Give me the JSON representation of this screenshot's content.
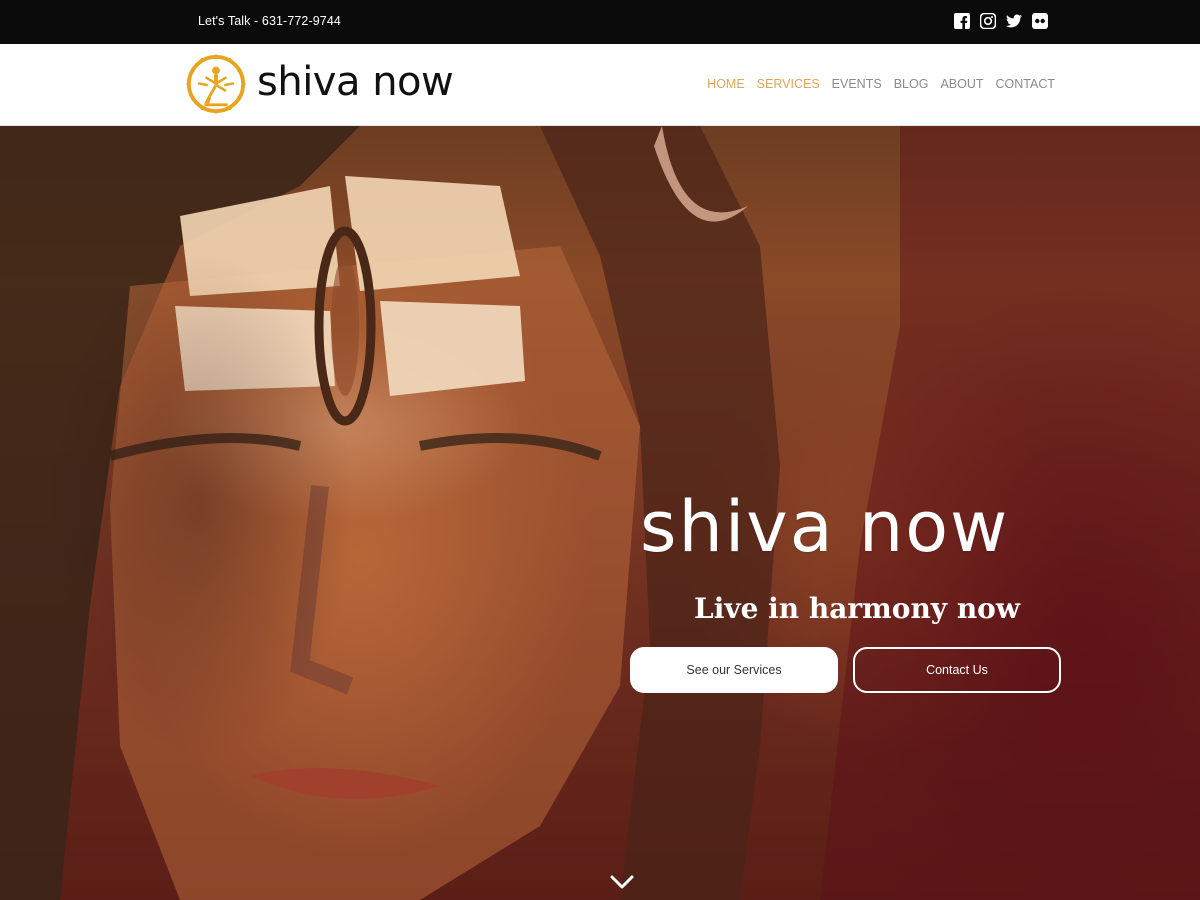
{
  "topbar": {
    "phone_text": "Let's Talk - 631-772-9744",
    "socials": [
      {
        "name": "facebook-icon"
      },
      {
        "name": "instagram-icon"
      },
      {
        "name": "twitter-icon"
      },
      {
        "name": "flickr-icon"
      }
    ]
  },
  "header": {
    "logo_text": "shiva now",
    "nav": [
      {
        "label": "HOME",
        "active": true
      },
      {
        "label": "SERVICES",
        "active": true
      },
      {
        "label": "EVENTS",
        "active": false
      },
      {
        "label": "BLOG",
        "active": false
      },
      {
        "label": "ABOUT",
        "active": false
      },
      {
        "label": "CONTACT",
        "active": false
      }
    ]
  },
  "hero": {
    "title": "shiva now",
    "subtitle": "Live in harmony now",
    "buttons": {
      "services": "See our Services",
      "contact": "Contact Us"
    }
  },
  "colors": {
    "accent": "#e0a458",
    "nav_default": "#8b8b8b",
    "topbar_bg": "#0b0b0b"
  }
}
